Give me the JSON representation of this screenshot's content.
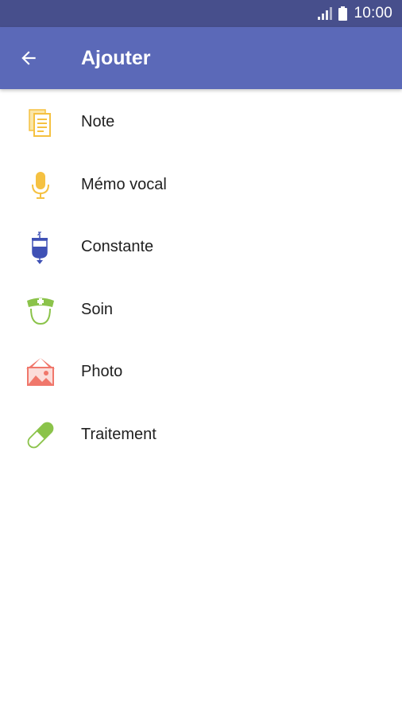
{
  "status_bar": {
    "time": "10:00",
    "icons": [
      "signal-icon",
      "battery-icon"
    ]
  },
  "app_bar": {
    "title": "Ajouter",
    "back_icon": "arrow-back-icon",
    "background_color": "#5b69b8",
    "status_color": "#474f8c"
  },
  "menu": {
    "items": [
      {
        "label": "Note",
        "icon": "note-icon",
        "color": "#f5c141"
      },
      {
        "label": "Mémo vocal",
        "icon": "microphone-icon",
        "color": "#f5c141"
      },
      {
        "label": "Constante",
        "icon": "iv-bag-icon",
        "color": "#3f51b5"
      },
      {
        "label": "Soin",
        "icon": "nurse-icon",
        "color": "#8bc34a"
      },
      {
        "label": "Photo",
        "icon": "photo-icon",
        "color": "#f0776b"
      },
      {
        "label": "Traitement",
        "icon": "pill-icon",
        "color": "#8bc34a"
      }
    ]
  }
}
